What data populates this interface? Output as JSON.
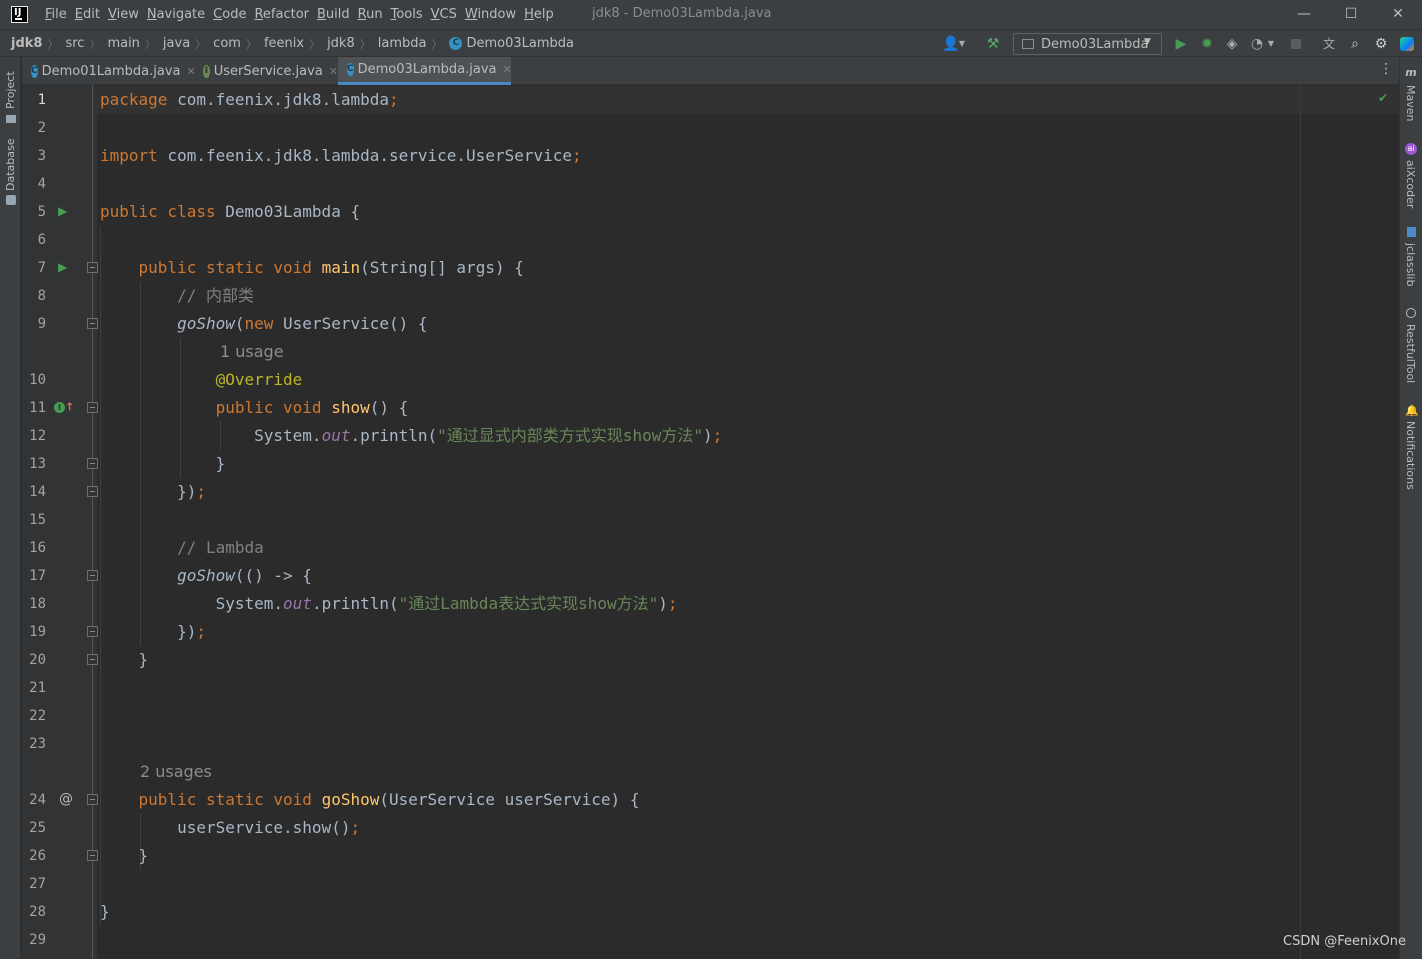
{
  "titlebar": {
    "menu": [
      "File",
      "Edit",
      "View",
      "Navigate",
      "Code",
      "Refactor",
      "Build",
      "Run",
      "Tools",
      "VCS",
      "Window",
      "Help"
    ],
    "window_title": "jdk8 - Demo03Lambda.java",
    "min": "—",
    "max": "☐",
    "close": "✕"
  },
  "breadcrumbs": [
    "jdk8",
    "src",
    "main",
    "java",
    "com",
    "feenix",
    "jdk8",
    "lambda",
    "Demo03Lambda"
  ],
  "toolbar": {
    "run_config": "Demo03Lambda"
  },
  "tabs": [
    {
      "label": "Demo01Lambda.java",
      "icon": "c"
    },
    {
      "label": "UserService.java",
      "icon": "i"
    },
    {
      "label": "Demo03Lambda.java",
      "icon": "c",
      "active": true
    }
  ],
  "left_tools": [
    "Project",
    "Database"
  ],
  "right_tools": [
    "Maven",
    "aiXcoder",
    "jclasslib",
    "RestfulTool",
    "Notifications"
  ],
  "editor": {
    "line_numbers": [
      "1",
      "2",
      "3",
      "4",
      "5",
      "6",
      "7",
      "8",
      "9",
      "10",
      "11",
      "12",
      "13",
      "14",
      "15",
      "16",
      "17",
      "18",
      "19",
      "20",
      "21",
      "22",
      "23",
      "24",
      "25",
      "26",
      "27",
      "28",
      "29"
    ],
    "code": {
      "l1_kw": "package",
      "l1_pkg": " com.feenix.jdk8.lambda",
      "l3_kw": "import",
      "l3_pkg": " com.feenix.jdk8.lambda.service.UserService",
      "l5_kw": "public class",
      "l5_name": " Demo03Lambda {",
      "l7_kw": "public static void",
      "l7_fn": "main",
      "l7_rest": "(String[] args) {",
      "l8_comment": "// 内部类",
      "l9_call": "goShow",
      "l9_kw": "new",
      "l9_rest": " UserService() {",
      "usage_1": "1 usage",
      "l10_ann": "@Override",
      "l11_kw": "public void",
      "l11_fn": "show",
      "l11_rest": "() {",
      "l12_a": "System.",
      "l12_out": "out",
      "l12_b": ".println(",
      "l12_str": "\"通过显式内部类方式实现show方法\"",
      "l13": "}",
      "l14": "})",
      "l16_comment": "// Lambda",
      "l17_call": "goShow",
      "l17_rest": "(() -> {",
      "l18_a": "System.",
      "l18_out": "out",
      "l18_b": ".println(",
      "l18_str": "\"通过Lambda表达式实现show方法\"",
      "l19": "})",
      "l20": "}",
      "usage_2": "2 usages",
      "l24_kw": "public static void",
      "l24_fn": "goShow",
      "l24_rest": "(UserService userService) {",
      "l25": "userService.show()",
      "l26": "}",
      "l28": "}"
    }
  },
  "icons": {
    "run_gutter": "run-arrow-icon",
    "override_gutter": "implements-override-icon",
    "impl_gutter": "implemented-at-icon"
  },
  "watermark": "CSDN @FeenixOne"
}
